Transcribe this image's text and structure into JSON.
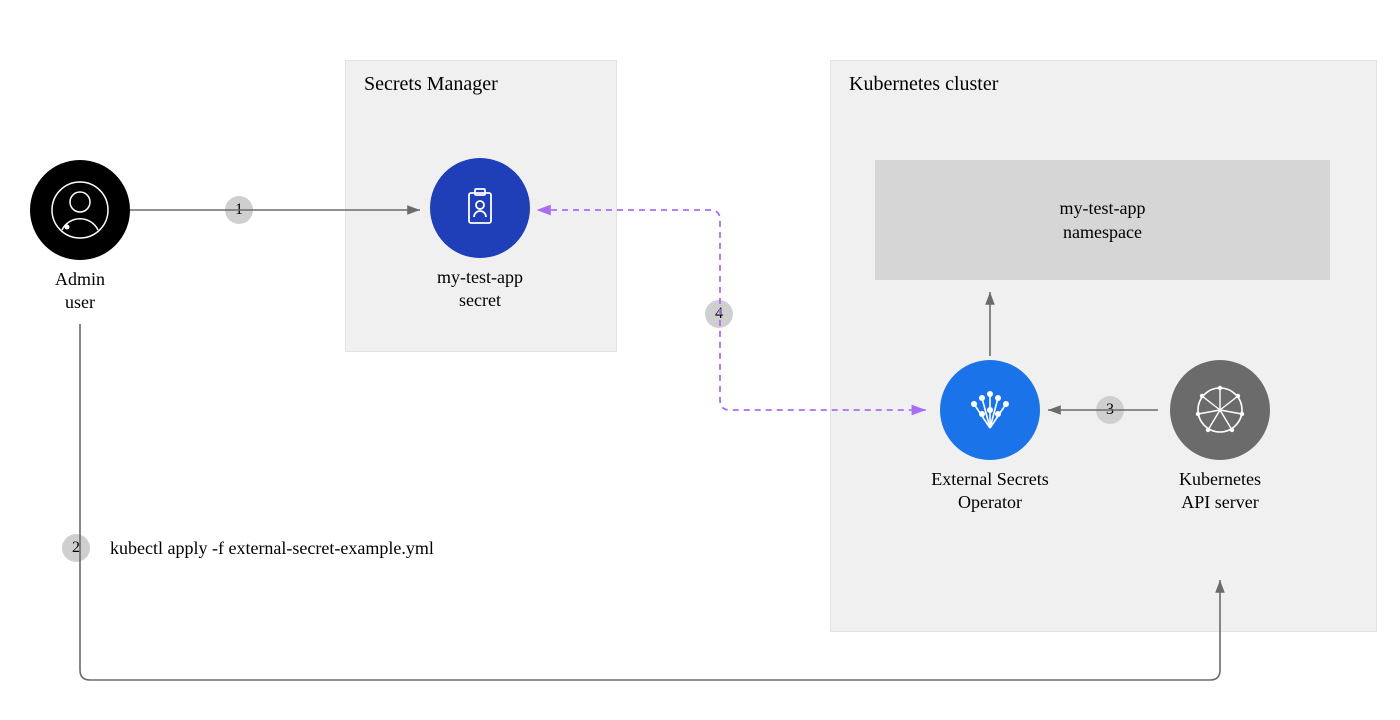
{
  "actors": {
    "admin": {
      "label": "Admin\nuser",
      "icon": "user-icon",
      "color": "#000000"
    },
    "secrets_manager": {
      "title": "Secrets Manager",
      "item_label": "my-test-app\nsecret",
      "icon": "secret-credential-icon",
      "color": "#1f3fb8"
    },
    "k8s_cluster": {
      "title": "Kubernetes cluster",
      "namespace_label": "my-test-app\nnamespace",
      "eso": {
        "label": "External Secrets\nOperator",
        "icon": "eso-icon",
        "color": "#1a73e8"
      },
      "api": {
        "label": "Kubernetes\nAPI server",
        "icon": "k8s-api-icon",
        "color": "#6b6b6b"
      }
    }
  },
  "steps": {
    "s1": "1",
    "s2": "2",
    "s3": "3",
    "s4": "4"
  },
  "command": "kubectl apply -f external-secret-example.yml",
  "colors": {
    "dashed_arrow": "#a96df2",
    "solid_arrow": "#6b6b6b",
    "badge_bg": "#cfcfcf"
  }
}
